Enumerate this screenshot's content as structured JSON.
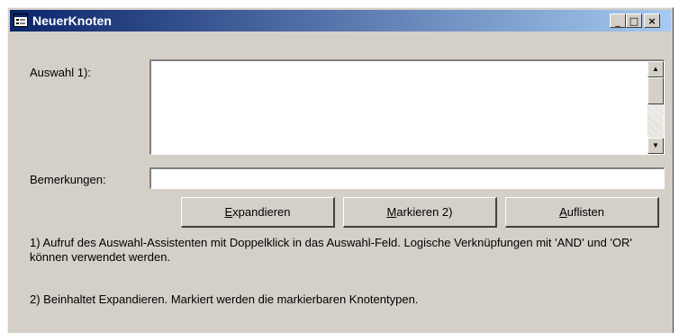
{
  "window": {
    "title": "NeuerKnoten",
    "controls": {
      "minimize": "_",
      "maximize": "□",
      "close": "×"
    }
  },
  "form": {
    "auswahl_label": "Auswahl 1):",
    "auswahl_value": "",
    "bemerkungen_label": "Bemerkungen:",
    "bemerkungen_value": ""
  },
  "buttons": {
    "expand": {
      "accel": "E",
      "rest": "xpandieren"
    },
    "mark": {
      "accel": "M",
      "rest": "arkieren 2)"
    },
    "list": {
      "accel": "A",
      "rest": "uflisten"
    }
  },
  "notes": {
    "note1": "1) Aufruf des Auswahl-Assistenten mit Doppelklick in das Auswahl-Feld. Logische Verknüpfungen mit 'AND' und 'OR' können verwendet werden.",
    "note2": "2) Beinhaltet Expandieren. Markiert werden die markierbaren Knotentypen."
  },
  "scrollbar": {
    "up": "▲",
    "down": "▼"
  },
  "colors": {
    "titlebar_start": "#0a246a",
    "titlebar_end": "#a6caf0",
    "face": "#d4d0c8"
  }
}
